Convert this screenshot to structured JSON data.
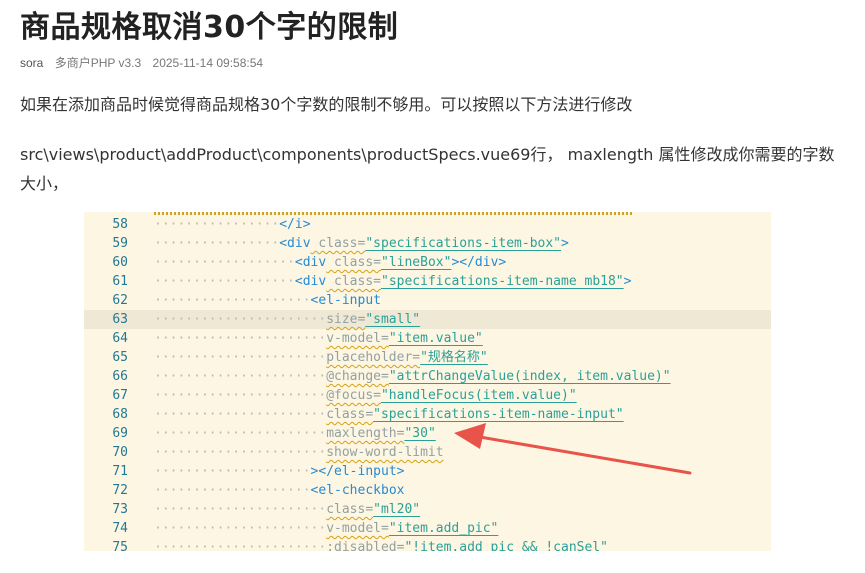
{
  "article": {
    "title": "商品规格取消30个字的限制",
    "author": "sora",
    "category": "多商户PHP v3.3",
    "date": "2025-11-14 09:58:54",
    "paragraph1": "如果在添加商品时候觉得商品规格30个字数的限制不够用。可以按照以下方法进行修改",
    "paragraph2": "src\\views\\product\\addProduct\\components\\productSpecs.vue69行， maxlength 属性修改成你需要的字数大小，"
  },
  "code": {
    "lines": [
      {
        "n": "58",
        "indent": 8,
        "parts": [
          [
            "tag",
            "</i>"
          ]
        ]
      },
      {
        "n": "59",
        "indent": 8,
        "parts": [
          [
            "tag",
            "<div"
          ],
          [
            "attr",
            " class="
          ],
          [
            "str",
            "\"specifications-item-box\""
          ],
          [
            "tag",
            ">"
          ]
        ]
      },
      {
        "n": "60",
        "indent": 9,
        "parts": [
          [
            "tag",
            "<div"
          ],
          [
            "attr",
            " class="
          ],
          [
            "str",
            "\"lineBox\""
          ],
          [
            "tag",
            "></div>"
          ]
        ]
      },
      {
        "n": "61",
        "indent": 9,
        "parts": [
          [
            "tag",
            "<div"
          ],
          [
            "attr",
            " class="
          ],
          [
            "str",
            "\"specifications-item-name mb18\""
          ],
          [
            "tag",
            ">"
          ]
        ]
      },
      {
        "n": "62",
        "indent": 10,
        "parts": [
          [
            "tag",
            "<el-input"
          ]
        ]
      },
      {
        "n": "63",
        "indent": 11,
        "parts": [
          [
            "attr",
            "size="
          ],
          [
            "str",
            "\"small\""
          ]
        ],
        "hl": true
      },
      {
        "n": "64",
        "indent": 11,
        "parts": [
          [
            "attr",
            "v-model="
          ],
          [
            "str",
            "\"item.value\""
          ]
        ]
      },
      {
        "n": "65",
        "indent": 11,
        "parts": [
          [
            "attr",
            "placeholder="
          ],
          [
            "str",
            "\"规格名称\""
          ]
        ]
      },
      {
        "n": "66",
        "indent": 11,
        "parts": [
          [
            "attr",
            "@change="
          ],
          [
            "str",
            "\"attrChangeValue(index, item.value)\""
          ]
        ]
      },
      {
        "n": "67",
        "indent": 11,
        "parts": [
          [
            "attr",
            "@focus="
          ],
          [
            "str",
            "\"handleFocus(item.value)\""
          ]
        ]
      },
      {
        "n": "68",
        "indent": 11,
        "parts": [
          [
            "attr",
            "class="
          ],
          [
            "str",
            "\"specifications-item-name-input\""
          ]
        ]
      },
      {
        "n": "69",
        "indent": 11,
        "parts": [
          [
            "attr",
            "maxlength="
          ],
          [
            "str",
            "\"30\""
          ]
        ]
      },
      {
        "n": "70",
        "indent": 11,
        "parts": [
          [
            "attr",
            "show-word-limit"
          ]
        ]
      },
      {
        "n": "71",
        "indent": 10,
        "parts": [
          [
            "tag",
            "></el-input>"
          ]
        ]
      },
      {
        "n": "72",
        "indent": 10,
        "parts": [
          [
            "tag",
            "<el-checkbox"
          ]
        ]
      },
      {
        "n": "73",
        "indent": 11,
        "parts": [
          [
            "attr",
            "class="
          ],
          [
            "str",
            "\"ml20\""
          ]
        ]
      },
      {
        "n": "74",
        "indent": 11,
        "parts": [
          [
            "attr",
            "v-model="
          ],
          [
            "str",
            "\"item.add_pic\""
          ]
        ]
      },
      {
        "n": "75",
        "indent": 11,
        "parts": [
          [
            "attr",
            ":disabled="
          ],
          [
            "str",
            "\"!item.add_pic && !canSel\""
          ]
        ]
      }
    ]
  },
  "colors": {
    "code_bg": "#fdf6e3",
    "arrow": "#e8534a",
    "line_number": "#237893"
  }
}
